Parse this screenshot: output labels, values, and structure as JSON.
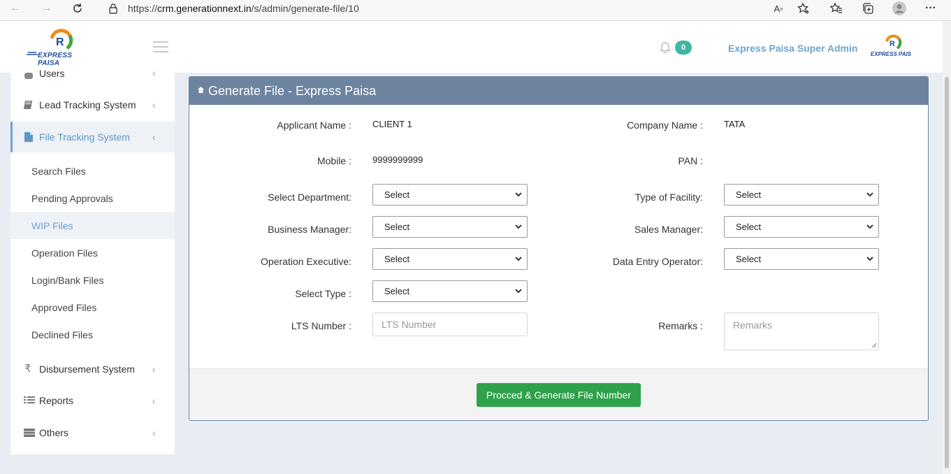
{
  "browser": {
    "url_prefix": "https://",
    "url_host": "crm.generationnext.in",
    "url_path": "/s/admin/generate-file/10"
  },
  "header": {
    "brand": "EXPRESS PAISA",
    "brand_small": "EXPRESS PAIS",
    "notifications_count": "0",
    "admin_name": "Express Paisa Super Admin"
  },
  "sidebar": {
    "items": [
      {
        "label": "Users",
        "icon": "user-icon"
      },
      {
        "label": "Lead Tracking System",
        "icon": "book-icon"
      },
      {
        "label": "File Tracking System",
        "icon": "file-icon"
      },
      {
        "label": "Disbursement System",
        "icon": "rupee-icon"
      },
      {
        "label": "Reports",
        "icon": "list-icon"
      },
      {
        "label": "Others",
        "icon": "table-icon"
      }
    ],
    "subitems": [
      "Search Files",
      "Pending Approvals",
      "WIP Files",
      "Operation Files",
      "Login/Bank Files",
      "Approved Files",
      "Declined Files"
    ],
    "active_item": "File Tracking System",
    "active_subitem": "WIP Files"
  },
  "panel": {
    "title": "Generate File - Express Paisa",
    "applicant_label": "Applicant Name :",
    "applicant_value": "CLIENT 1",
    "company_label": "Company Name :",
    "company_value": "TATA",
    "mobile_label": "Mobile :",
    "mobile_value": "9999999999",
    "pan_label": "PAN :",
    "department_label": "Select Department:",
    "facility_label": "Type of Facility:",
    "business_manager_label": "Business Manager:",
    "sales_manager_label": "Sales Manager:",
    "operation_exec_label": "Operation Executive:",
    "data_entry_label": "Data Entry Operator:",
    "select_type_label": "Select Type :",
    "select_value": "Select",
    "lts_label": "LTS Number :",
    "lts_placeholder": "LTS Number",
    "remarks_label": "Remarks :",
    "remarks_placeholder": "Remarks",
    "submit_label": "Procced & Generate File Number"
  },
  "colors": {
    "panel_header": "#6c84a0",
    "accent": "#6ea3cf",
    "badge": "#3fb7a3",
    "button": "#2ea14a"
  }
}
